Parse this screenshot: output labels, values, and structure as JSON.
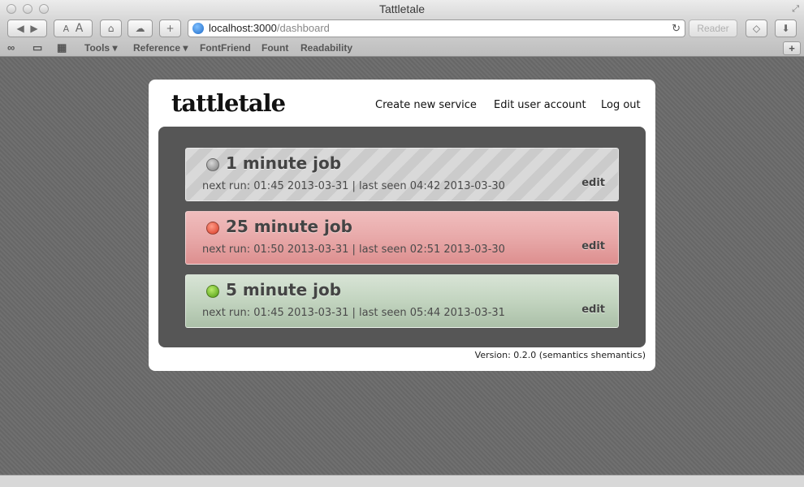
{
  "window": {
    "title": "Tattletale"
  },
  "toolbar": {
    "url_host": "localhost:3000",
    "url_path": "/dashboard",
    "reader_label": "Reader",
    "font_small": "A",
    "font_large": "A"
  },
  "bookmarks": {
    "items": [
      {
        "label": "Tools ▾"
      },
      {
        "label": "Reference ▾"
      },
      {
        "label": "FontFriend"
      },
      {
        "label": "Fount"
      },
      {
        "label": "Readability"
      }
    ]
  },
  "site": {
    "logo": "tattletale",
    "nav": [
      "Create new service",
      "Edit user account",
      "Log out"
    ],
    "version": "Version: 0.2.0 (semantics shemantics)"
  },
  "jobs": [
    {
      "name": "1 minute job",
      "status": "grey",
      "info": "next run: 01:45 2013-03-31 | last seen 04:42 2013-03-30",
      "edit_label": "edit"
    },
    {
      "name": "25 minute job",
      "status": "red",
      "info": "next run: 01:50 2013-03-31 | last seen 02:51 2013-03-30",
      "edit_label": "edit"
    },
    {
      "name": "5 minute job",
      "status": "green",
      "info": "next run: 01:45 2013-03-31 | last seen 05:44 2013-03-31",
      "edit_label": "edit"
    }
  ],
  "colors": {
    "status_red": "#d83a25",
    "status_green": "#4d9a12",
    "status_grey": "#7a7a7a"
  }
}
